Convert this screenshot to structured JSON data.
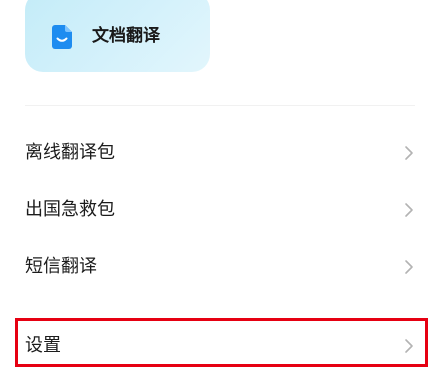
{
  "doc_translate_card": {
    "label": "文档翻译",
    "icon": "document-icon",
    "bg_color": "#c9eef9",
    "icon_color": "#1e8cf0"
  },
  "menu": {
    "items": [
      {
        "label": "离线翻译包",
        "icon": "chevron-right-icon"
      },
      {
        "label": "出国急救包",
        "icon": "chevron-right-icon"
      },
      {
        "label": "短信翻译",
        "icon": "chevron-right-icon"
      },
      {
        "label": "设置",
        "icon": "chevron-right-icon",
        "highlighted": true
      }
    ]
  },
  "highlight_color": "#e60012"
}
